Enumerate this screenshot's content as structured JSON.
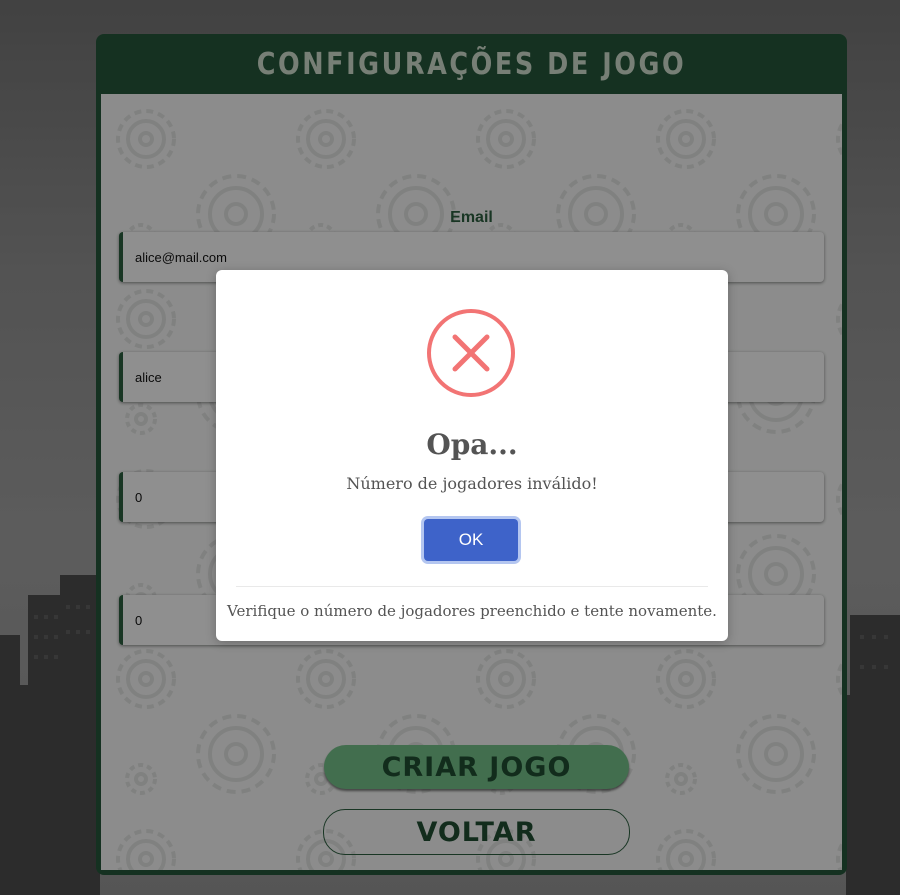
{
  "panel": {
    "title": "CONFIGURAÇÕES DE JOGO"
  },
  "form": {
    "email_label": "Email",
    "email_value": "alice@mail.com",
    "name_value": "alice",
    "field3_value": "0",
    "field4_value": "0"
  },
  "buttons": {
    "create_label": "CRIAR JOGO",
    "back_label": "VOLTAR"
  },
  "modal": {
    "title": "Opa...",
    "message": "Número de jogadores inválido!",
    "ok_label": "OK",
    "footer": "Verifique o número de jogadores preenchido e tente novamente.",
    "icon": "error-x-icon"
  },
  "colors": {
    "panel_green": "#235338",
    "accent_green": "#6fb783",
    "error_red": "#f27474",
    "ok_blue": "#3e63c9"
  }
}
